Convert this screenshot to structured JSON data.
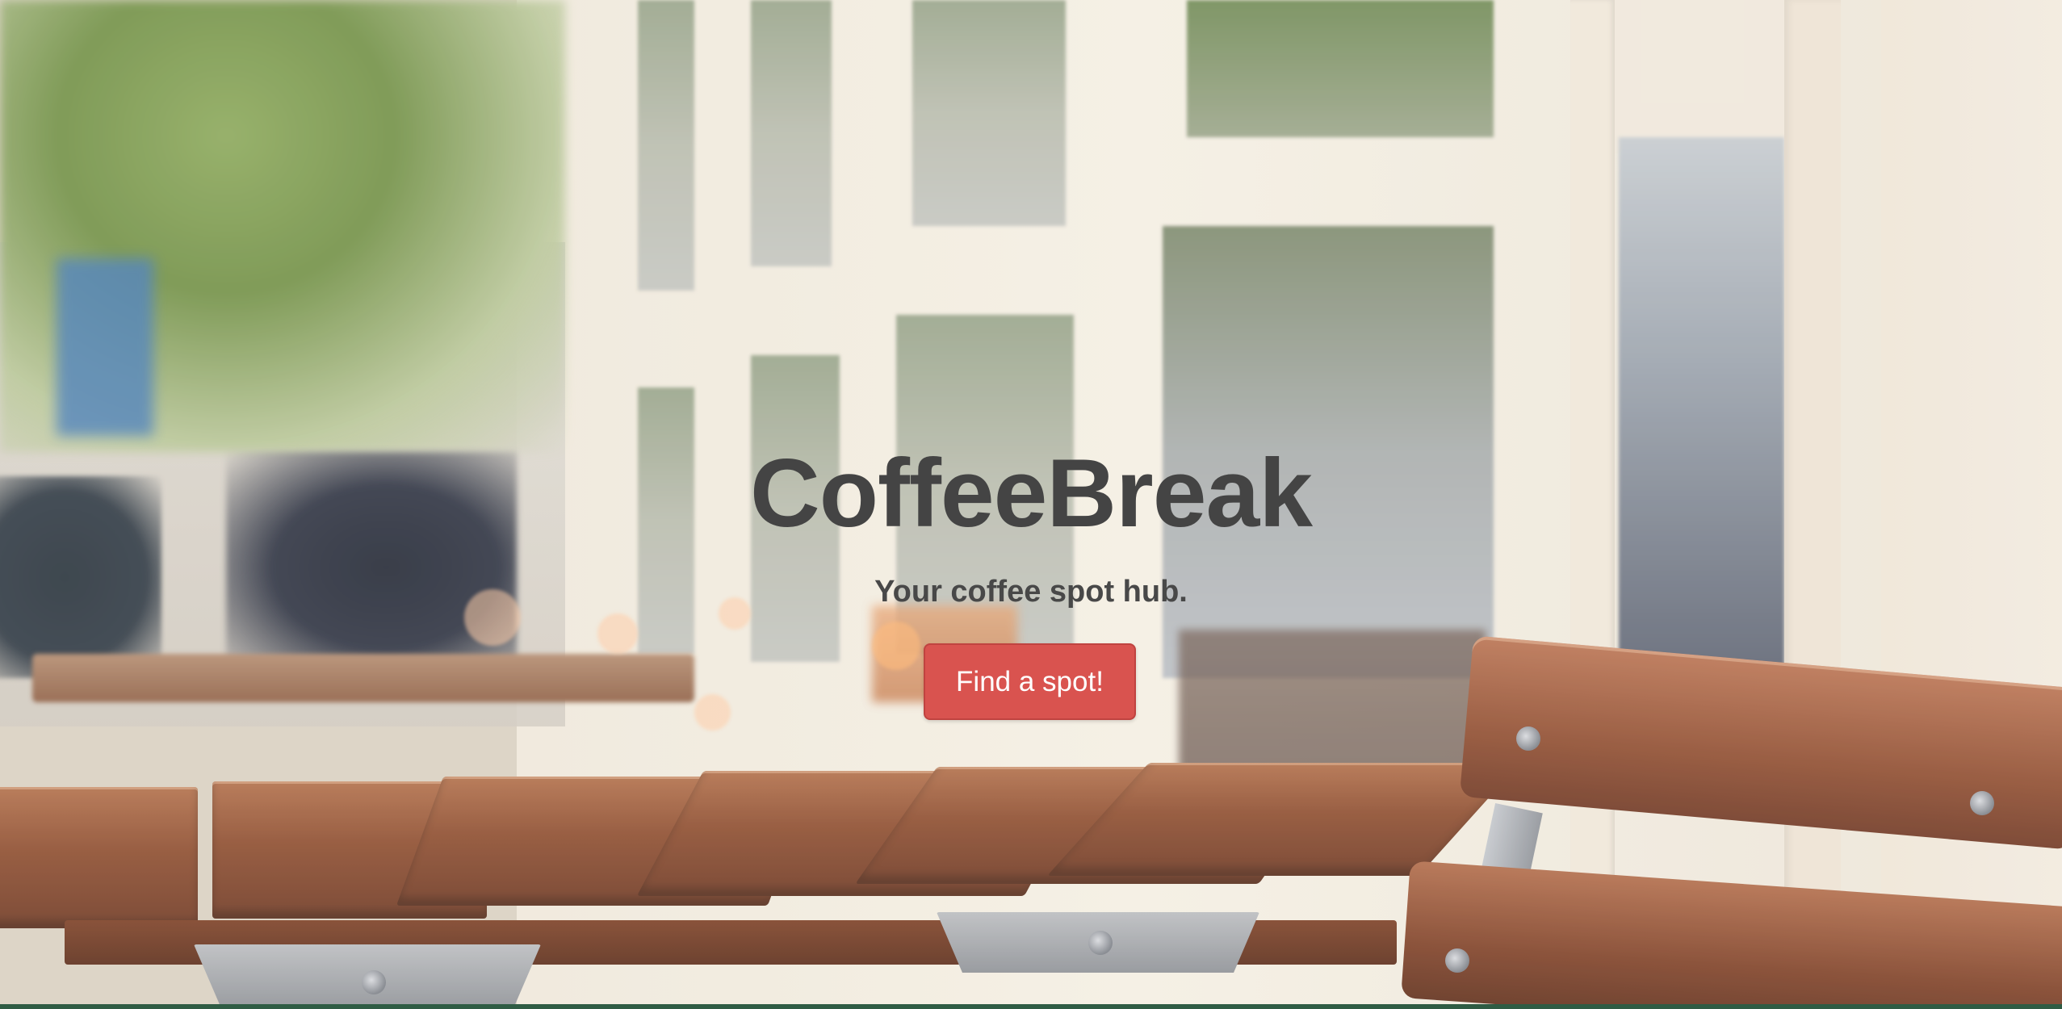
{
  "hero": {
    "title": "CoffeeBreak",
    "tagline": "Your coffee spot hub.",
    "cta_label": "Find a spot!"
  },
  "colors": {
    "title_text": "#444444",
    "cta_background": "#d9534f",
    "cta_text": "#ffffff"
  },
  "background": {
    "icon": "cafe-terrace-photo"
  }
}
